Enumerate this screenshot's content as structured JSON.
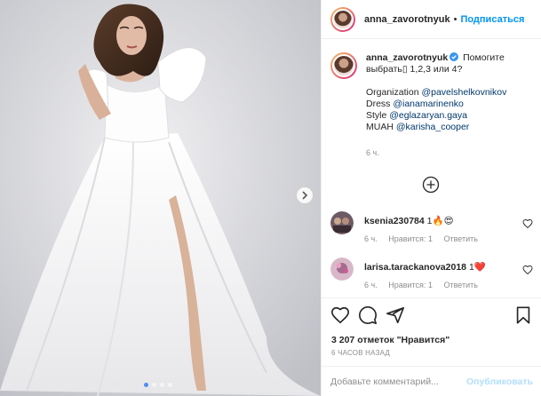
{
  "post": {
    "username": "anna_zavorotnyuk",
    "separator": "•",
    "follow_label": "Подписаться",
    "caption": {
      "username": "anna_zavorotnyuk",
      "text_line1": "Помогите",
      "text_line2": "выбрать▯ 1,2,3 или 4?",
      "org_label": "Organization",
      "org_mention": "@pavelshelkovnikov",
      "dress_label": "Dress",
      "dress_mention": "@ianamarinenko",
      "style_label": "Style",
      "style_mention": "@eglazaryan.gaya",
      "muah_label": "MUAH",
      "muah_mention": "@karisha_cooper",
      "time": "6 ч."
    },
    "comments": [
      {
        "username": "ksenia230784",
        "text": "1🔥😍",
        "time": "6 ч.",
        "likes": "Нравится: 1",
        "reply": "Ответить"
      },
      {
        "username": "larisa.tarackanova2018",
        "text": "1❤️",
        "time": "6 ч.",
        "likes": "Нравится: 1",
        "reply": "Ответить"
      }
    ],
    "likes_count": "3 207 отметок",
    "likes_quote": "\"Нравится\"",
    "posted_ago": "6 ЧАСОВ НАЗАД",
    "add_comment_placeholder": "Добавьте комментарий...",
    "publish_label": "Опубликовать",
    "carousel": {
      "total": 4,
      "active": 1
    }
  },
  "colors": {
    "link": "#0095f6",
    "mention": "#00376b",
    "muted": "#8e8e8e",
    "heart": "#ed4956"
  }
}
